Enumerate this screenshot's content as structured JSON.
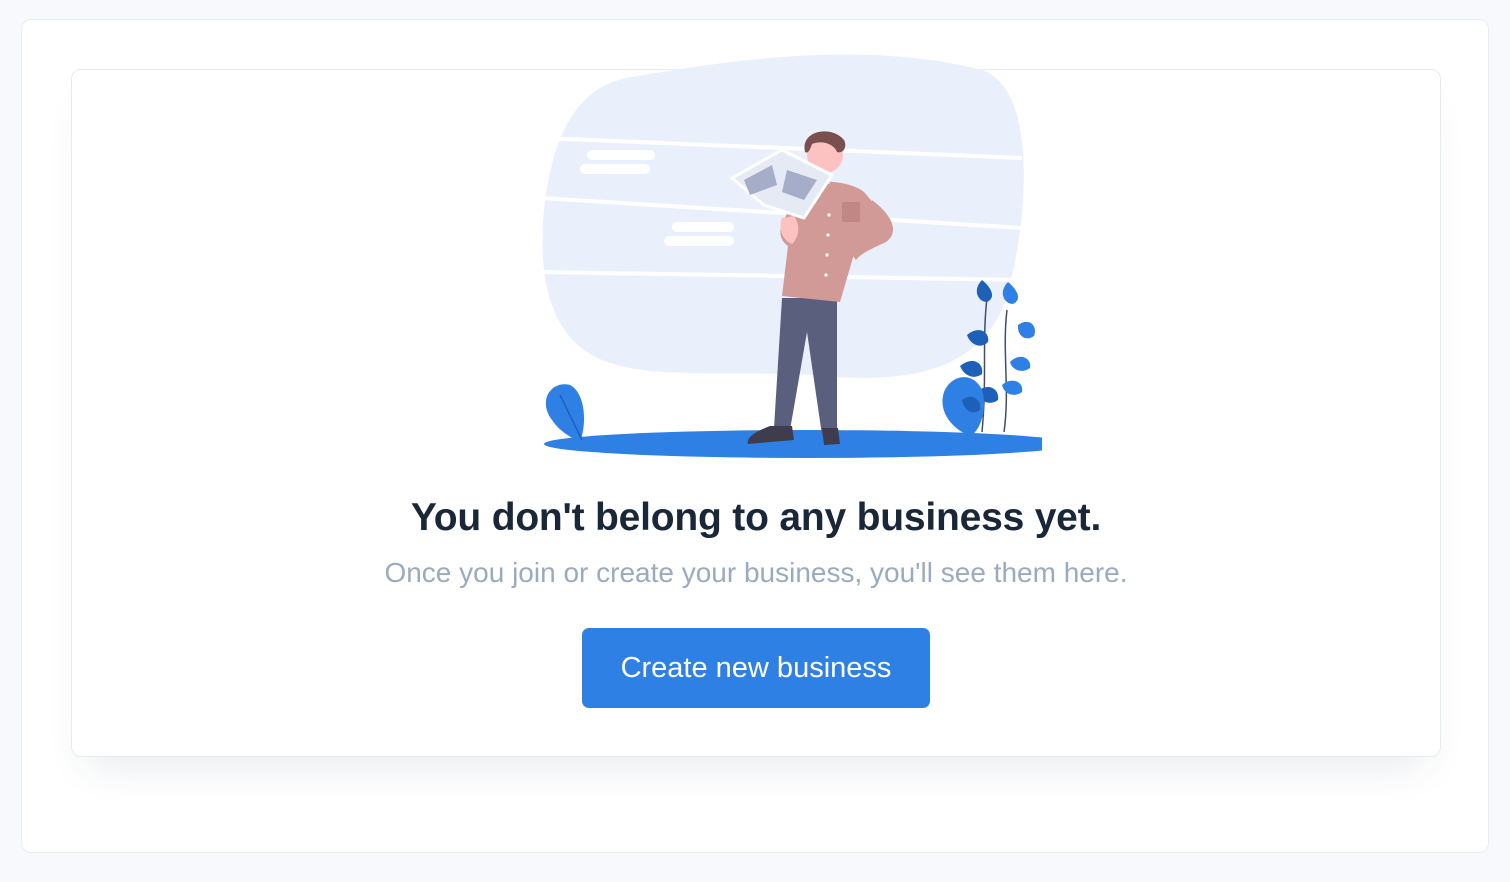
{
  "empty_state": {
    "title": "You don't belong to any business yet.",
    "subtitle": "Once you join or create your business, you'll see them here.",
    "button_label": "Create new business",
    "illustration": "person-holding-map"
  },
  "colors": {
    "accent": "#2f80e4",
    "title": "#1a2738",
    "subtitle": "#9aabc0",
    "blob": "#eaf0fb"
  }
}
